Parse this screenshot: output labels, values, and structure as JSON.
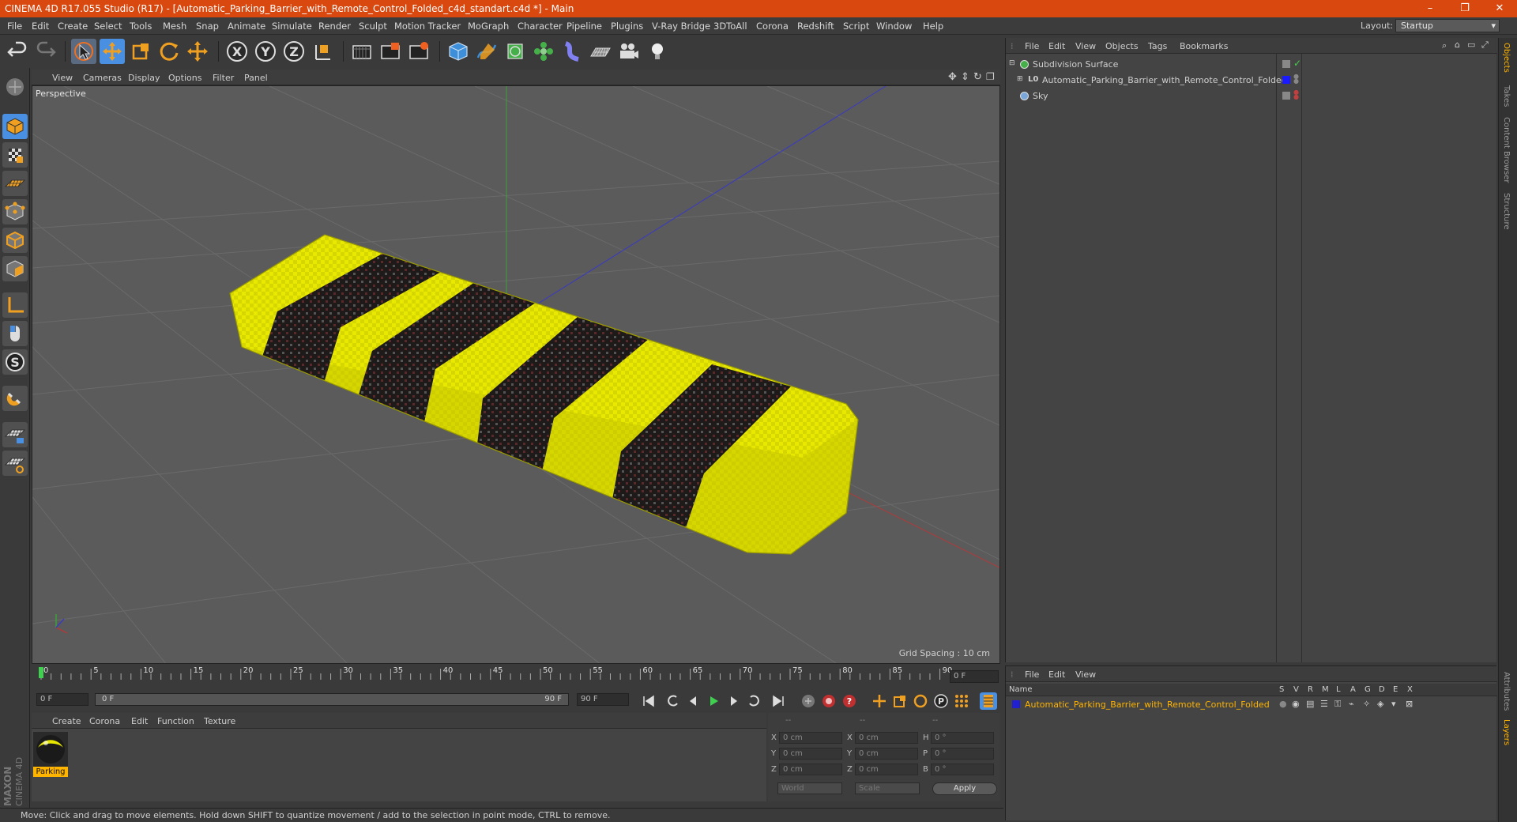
{
  "window": {
    "title": "CINEMA 4D R17.055 Studio (R17) - [Automatic_Parking_Barrier_with_Remote_Control_Folded_c4d_standart.c4d *] - Main",
    "minimize": "–",
    "maximize": "❐",
    "close": "✕"
  },
  "menubar": {
    "items": [
      "File",
      "Edit",
      "Create",
      "Select",
      "Tools",
      "Mesh",
      "Snap",
      "Animate",
      "Simulate",
      "Render",
      "Sculpt",
      "Motion Tracker",
      "MoGraph",
      "Character",
      "Pipeline",
      "Plugins",
      "V-Ray Bridge",
      "3DToAll",
      "Corona",
      "Redshift",
      "Script",
      "Window",
      "Help"
    ],
    "layout_label": "Layout:",
    "layout_value": "Startup"
  },
  "toolbar": {
    "icons": [
      "undo-icon",
      "redo-icon",
      "select-arrow-icon",
      "move-icon",
      "scale-icon",
      "rotate-icon",
      "live-select-icon",
      "x-axis-icon",
      "y-axis-icon",
      "z-axis-icon",
      "coordinate-system-icon",
      "render-view-icon",
      "render-picture-viewer-icon",
      "edit-render-settings-icon",
      "cube-object-icon",
      "spline-pen-icon",
      "subdivision-icon",
      "mograph-cloner-icon",
      "deformer-icon",
      "floor-icon",
      "camera-icon",
      "light-icon"
    ],
    "axis_labels": [
      "X",
      "Y",
      "Z"
    ]
  },
  "viewport": {
    "menu": [
      "View",
      "Cameras",
      "Display",
      "Options",
      "Filter",
      "Panel"
    ],
    "label": "Perspective",
    "grid_spacing": "Grid Spacing : 10 cm"
  },
  "timeline": {
    "ticks": [
      "0",
      "5",
      "10",
      "15",
      "20",
      "25",
      "30",
      "35",
      "40",
      "45",
      "50",
      "55",
      "60",
      "65",
      "70",
      "75",
      "80",
      "85",
      "90"
    ],
    "current_frame_field": "0 F",
    "start_field": "0 F",
    "range_start": "0 F",
    "range_end": "90 F",
    "end_field": "90 F"
  },
  "materials": {
    "menu": [
      "Create",
      "Corona",
      "Edit",
      "Function",
      "Texture"
    ],
    "items": [
      {
        "name": "Parking"
      }
    ]
  },
  "coordinates": {
    "headers": [
      "--",
      "--",
      "--"
    ],
    "rows": [
      {
        "a": "X",
        "av": "0 cm",
        "b": "X",
        "bv": "0 cm",
        "c": "H",
        "cv": "0 °"
      },
      {
        "a": "Y",
        "av": "0 cm",
        "b": "Y",
        "bv": "0 cm",
        "c": "P",
        "cv": "0 °"
      },
      {
        "a": "Z",
        "av": "0 cm",
        "b": "Z",
        "bv": "0 cm",
        "c": "B",
        "cv": "0 °"
      }
    ],
    "world": "World",
    "scale": "Scale",
    "apply": "Apply"
  },
  "object_manager": {
    "menu": [
      "File",
      "Edit",
      "View",
      "Objects",
      "Tags",
      "Bookmarks"
    ],
    "objects": [
      {
        "name": "Subdivision Surface",
        "color": "#45b04a"
      },
      {
        "name": "Automatic_Parking_Barrier_with_Remote_Control_Folded",
        "color": "#1a1aff"
      },
      {
        "name": "Sky",
        "color": "#7aa7d8"
      }
    ]
  },
  "layers": {
    "menu": [
      "File",
      "Edit",
      "View"
    ],
    "columns": [
      "Name",
      "S",
      "V",
      "R",
      "M",
      "L",
      "A",
      "G",
      "D",
      "E",
      "X"
    ],
    "rows": [
      {
        "name": "Automatic_Parking_Barrier_with_Remote_Control_Folded",
        "color": "#2020d0"
      }
    ]
  },
  "right_tabs": [
    "Objects",
    "Takes",
    "Content Browser",
    "Structure",
    "Attributes",
    "Layers"
  ],
  "status": {
    "text": "Move: Click and drag to move elements. Hold down SHIFT to quantize movement / add to the selection in point mode, CTRL to remove."
  },
  "brand": {
    "maxon": "MAXON",
    "cinema": "CINEMA 4D"
  },
  "colors": {
    "titlebar": "#d9480f",
    "accent_blue": "#3c8fd8",
    "object_yellow": "#e6e600",
    "stripe_black": "#1e1a1a",
    "highlight_orange": "#ffb400"
  }
}
